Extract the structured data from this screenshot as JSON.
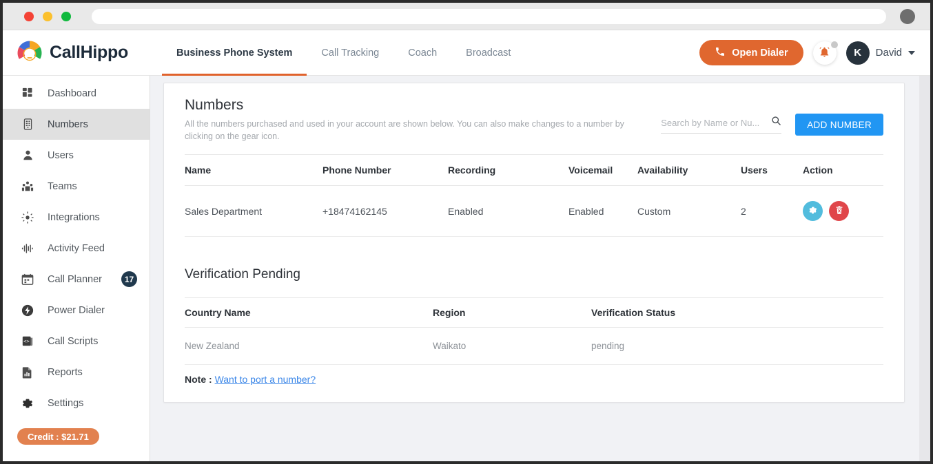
{
  "browser": {
    "traffic_lights": [
      "red",
      "yellow",
      "green"
    ],
    "url_value": "",
    "profile_icon": "user-circle-icon"
  },
  "header": {
    "brand": "CallHippo",
    "logo_icon": "callhippo-logo-icon",
    "tabs": [
      {
        "label": "Business Phone System",
        "active": true
      },
      {
        "label": "Call Tracking",
        "active": false
      },
      {
        "label": "Coach",
        "active": false
      },
      {
        "label": "Broadcast",
        "active": false
      }
    ],
    "dialer_button": {
      "label": "Open Dialer",
      "icon": "phone-icon",
      "color": "#e0672f"
    },
    "notifications": {
      "icon": "bell-icon",
      "has_badge": true
    },
    "user": {
      "initial": "K",
      "name": "David",
      "caret": "chevron-down-icon"
    }
  },
  "sidebar": {
    "items": [
      {
        "label": "Dashboard",
        "icon": "grid-dashboard-icon",
        "active": false,
        "badge": ""
      },
      {
        "label": "Numbers",
        "icon": "keypad-icon",
        "active": true,
        "badge": ""
      },
      {
        "label": "Users",
        "icon": "person-icon",
        "active": false,
        "badge": ""
      },
      {
        "label": "Teams",
        "icon": "people-group-icon",
        "active": false,
        "badge": ""
      },
      {
        "label": "Integrations",
        "icon": "integrations-icon",
        "active": false,
        "badge": ""
      },
      {
        "label": "Activity Feed",
        "icon": "waveform-icon",
        "active": false,
        "badge": ""
      },
      {
        "label": "Call Planner",
        "icon": "calendar-icon",
        "active": false,
        "badge": "17"
      },
      {
        "label": "Power Dialer",
        "icon": "bolt-icon",
        "active": false,
        "badge": ""
      },
      {
        "label": "Call Scripts",
        "icon": "script-code-icon",
        "active": false,
        "badge": ""
      },
      {
        "label": "Reports",
        "icon": "report-chart-icon",
        "active": false,
        "badge": ""
      },
      {
        "label": "Settings",
        "icon": "gear-icon",
        "active": false,
        "badge": ""
      }
    ],
    "credit": "Credit : $21.71"
  },
  "main": {
    "title": "Numbers",
    "subtitle": "All the numbers purchased and used in your account are shown below. You can also make changes to a number by clicking on the gear icon.",
    "search": {
      "placeholder": "Search by Name or Nu...",
      "value": "",
      "icon": "search-icon"
    },
    "add_button": {
      "label": "ADD NUMBER",
      "color": "#2196f3"
    },
    "numbers_table": {
      "columns": [
        "Name",
        "Phone Number",
        "Recording",
        "Voicemail",
        "Availability",
        "Users",
        "Action"
      ],
      "rows": [
        {
          "name": "Sales Department",
          "phone": "+18474162145",
          "recording": "Enabled",
          "voicemail": "Enabled",
          "availability": "Custom",
          "users": "2",
          "actions": [
            "gear-icon",
            "trash-icon"
          ]
        }
      ]
    },
    "verification": {
      "title": "Verification Pending",
      "columns": [
        "Country Name",
        "Region",
        "Verification Status"
      ],
      "rows": [
        {
          "country": "New Zealand",
          "region": "Waikato",
          "status": "pending"
        }
      ],
      "note_label": "Note :",
      "note_link": "Want to port a number?"
    }
  }
}
